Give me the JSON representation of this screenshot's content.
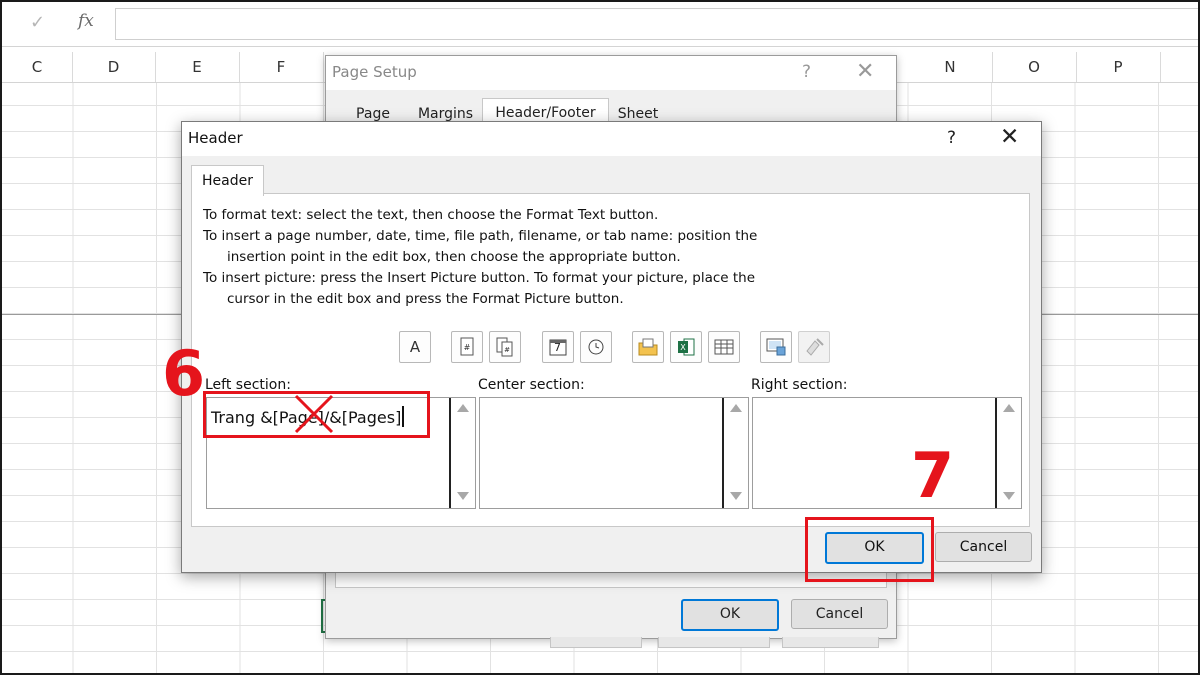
{
  "formula_bar": {
    "check_glyph": "✓",
    "fx_label": "fx"
  },
  "columns": [
    "C",
    "D",
    "E",
    "F",
    "N",
    "O",
    "P"
  ],
  "page_setup": {
    "title": "Page Setup",
    "help_glyph": "?",
    "close_glyph": "✕",
    "tabs": [
      "Page",
      "Margins",
      "Header/Footer",
      "Sheet"
    ],
    "active_tab": "Header/Footer",
    "ok_label": "OK",
    "cancel_label": "Cancel"
  },
  "header_dialog": {
    "title": "Header",
    "help_glyph": "?",
    "close_glyph": "✕",
    "tab_label": "Header",
    "instructions": [
      "To format text:  select the text, then choose the Format Text button.",
      "To insert a page number, date, time, file path, filename, or tab name:  position the",
      "insertion point in the edit box, then choose the appropriate button.",
      "To insert picture: press the Insert Picture button.  To format your picture, place the",
      "cursor in the edit box and press the Format Picture button."
    ],
    "toolbar_icons": [
      "format-text-icon",
      "insert-page-number-icon",
      "insert-number-of-pages-icon",
      "insert-date-icon",
      "insert-time-icon",
      "insert-file-path-icon",
      "insert-file-name-icon",
      "insert-sheet-name-icon",
      "insert-picture-icon",
      "format-picture-icon"
    ],
    "format_text_glyph": "A",
    "date_glyph": "7",
    "sections": {
      "left": {
        "label": "Left section:",
        "value": "Trang &[Page]/&[Pages]"
      },
      "center": {
        "label": "Center section:",
        "value": ""
      },
      "right": {
        "label": "Right section:",
        "value": ""
      }
    },
    "ok_label": "OK",
    "cancel_label": "Cancel"
  },
  "annotations": {
    "step_6": "6",
    "step_7": "7",
    "accent_color": "#e5141c"
  },
  "colors": {
    "dialog_bg": "#f0f0f0",
    "ok_border": "#0078d7",
    "excel_green": "#217346"
  }
}
